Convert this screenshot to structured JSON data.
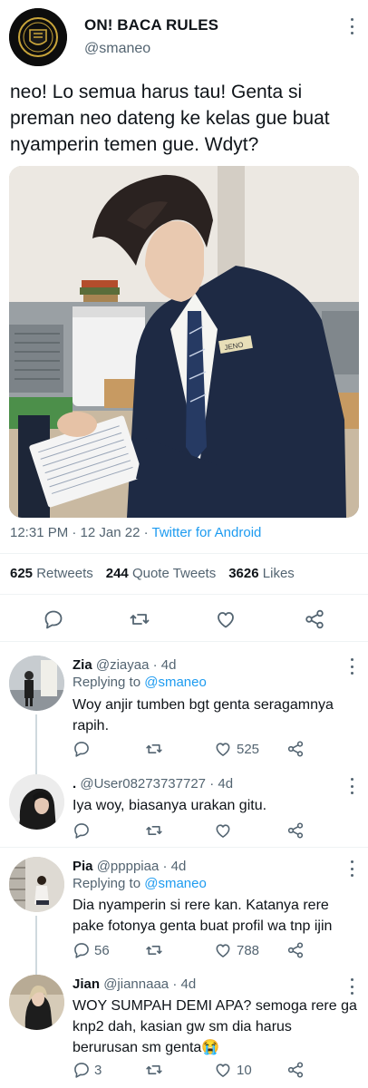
{
  "tweet": {
    "author_name": "ON! BACA RULES",
    "author_handle": "@smaneo",
    "text": "neo! Lo semua harus tau! Genta si preman neo dateng ke kelas gue buat nyamperin temen gue. Wdyt?",
    "name_tag": "JENO",
    "time": "12:31 PM · 12 Jan 22 · ",
    "source": "Twitter for Android",
    "retweets": "625",
    "retweets_label": "Retweets",
    "quotes": "244",
    "quotes_label": "Quote Tweets",
    "likes": "3626",
    "likes_label": "Likes"
  },
  "replies": [
    {
      "name": "Zia",
      "handle": "@ziayaa",
      "age": "· 4d",
      "replying_prefix": "Replying to ",
      "replying_to": "@smaneo",
      "text": "Woy anjir tumben bgt genta seragamnya rapih.",
      "reply_count": "",
      "like_count": "525"
    },
    {
      "name": ".",
      "handle": "@User08273737727",
      "age": "· 4d",
      "text": "Iya woy, biasanya urakan gitu.",
      "reply_count": "",
      "like_count": ""
    },
    {
      "name": "Pia",
      "handle": "@ppppiaa",
      "age": "· 4d",
      "replying_prefix": "Replying to ",
      "replying_to": "@smaneo",
      "text": "Dia nyamperin si rere kan. Katanya rere pake fotonya genta buat profil wa tnp ijin",
      "reply_count": "56",
      "like_count": "788"
    },
    {
      "name": "Jian",
      "handle": "@jiannaaa",
      "age": "· 4d",
      "text": "WOY SUMPAH DEMI APA? semoga rere ga knp2 dah, kasian gw sm dia harus berurusan sm genta😭",
      "reply_count": "3",
      "like_count": "10"
    }
  ],
  "icons": [
    "reply-icon",
    "retweet-icon",
    "like-icon",
    "share-icon",
    "more-icon"
  ],
  "colors": {
    "link": "#1d9bf0",
    "text": "#0f1419",
    "muted": "#536471"
  }
}
